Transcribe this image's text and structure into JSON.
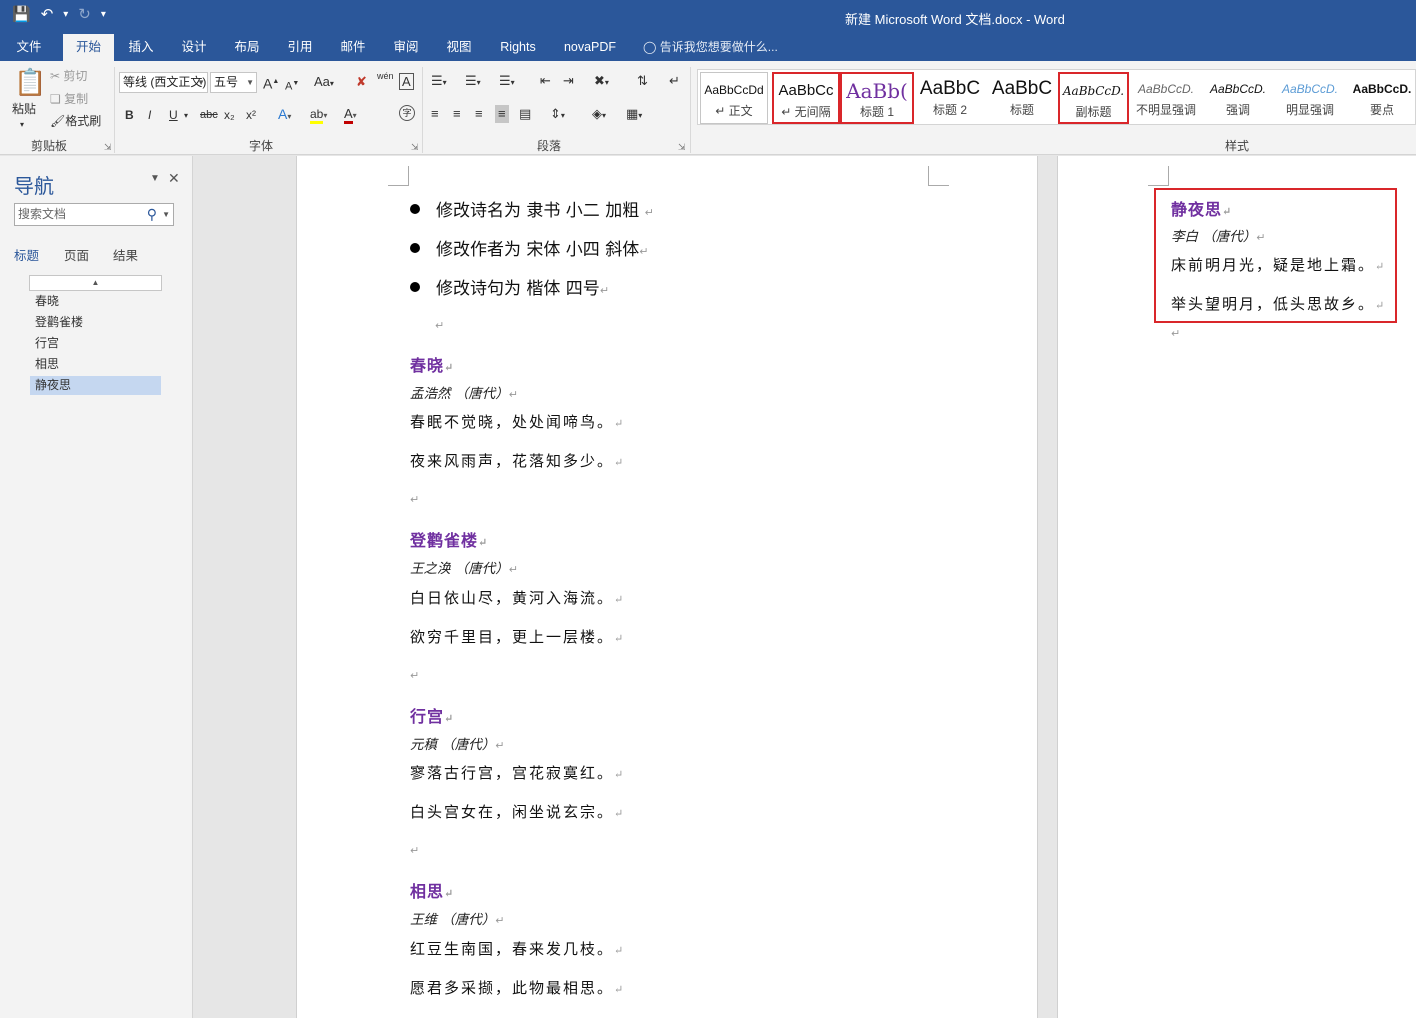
{
  "window": {
    "title": "新建 Microsoft Word 文档.docx - Word"
  },
  "qat": {
    "save_icon": "save-icon",
    "undo_icon": "undo-icon",
    "redo_icon": "redo-icon"
  },
  "tabs": [
    "文件",
    "开始",
    "插入",
    "设计",
    "布局",
    "引用",
    "邮件",
    "审阅",
    "视图",
    "Rights",
    "novaPDF"
  ],
  "tell_me": "告诉我您想要做什么...",
  "clipboard": {
    "paste": "粘贴",
    "cut": "剪切",
    "copy": "复制",
    "format_painter": "格式刷",
    "label": "剪贴板"
  },
  "font": {
    "name": "等线 (西文正文)",
    "size": "五号",
    "label": "字体",
    "bold": "B",
    "italic": "I",
    "underline": "U",
    "strike": "abc",
    "sub": "x₂",
    "sup": "x²",
    "grow": "A",
    "shrink": "A",
    "case": "Aa",
    "clear": "清",
    "phonetic": "wén",
    "border": "A",
    "effect": "A",
    "highlight": "ab",
    "color": "A",
    "enclose": "字"
  },
  "paragraph": {
    "label": "段落"
  },
  "styles": {
    "label": "样式",
    "items": [
      {
        "preview": "AaBbCcDd",
        "name": "↵ 正文"
      },
      {
        "preview": "AaBbCc",
        "name": "↵ 无间隔"
      },
      {
        "preview": "AaBb(",
        "name": "标题 1"
      },
      {
        "preview": "AaBbC",
        "name": "标题 2"
      },
      {
        "preview": "AaBbC",
        "name": "标题"
      },
      {
        "preview": "AaBbCcD.",
        "name": "副标题"
      },
      {
        "preview": "AaBbCcD.",
        "name": "不明显强调"
      },
      {
        "preview": "AaBbCcD.",
        "name": "强调"
      },
      {
        "preview": "AaBbCcD.",
        "name": "明显强调"
      },
      {
        "preview": "AaBbCcD.",
        "name": "要点"
      }
    ]
  },
  "nav": {
    "title": "导航",
    "search_placeholder": "搜索文档",
    "tabs": [
      "标题",
      "页面",
      "结果"
    ],
    "items": [
      "春晓",
      "登鹳雀楼",
      "行宫",
      "相思",
      "静夜思"
    ]
  },
  "document": {
    "bullets": [
      "修改诗名为 隶书 小二 加粗",
      "修改作者为 宋体 小四 斜体",
      "修改诗句为 楷体 四号"
    ],
    "para_mark": "↵",
    "poems": [
      {
        "title": "春晓",
        "author": "孟浩然 （唐代）",
        "lines": [
          "春眠不觉晓，处处闻啼鸟。",
          "夜来风雨声，花落知多少。"
        ]
      },
      {
        "title": "登鹳雀楼",
        "author": "王之涣 （唐代）",
        "lines": [
          "白日依山尽，黄河入海流。",
          "欲穷千里目，更上一层楼。"
        ]
      },
      {
        "title": "行宫",
        "author": "元稹 （唐代）",
        "lines": [
          "寥落古行宫，宫花寂寞红。",
          "白头宫女在，闲坐说玄宗。"
        ]
      },
      {
        "title": "相思",
        "author": "王维 （唐代）",
        "lines": [
          "红豆生南国，春来发几枝。",
          "愿君多采撷，此物最相思。"
        ]
      }
    ],
    "page2_poem": {
      "title": "静夜思",
      "author": "李白 （唐代）",
      "lines": [
        "床前明月光，疑是地上霜。",
        "举头望明月，低头思故乡。"
      ]
    }
  },
  "colors": {
    "accent": "#2b579a",
    "heading_purple": "#7030a0",
    "annotation_red": "#d9262a"
  }
}
